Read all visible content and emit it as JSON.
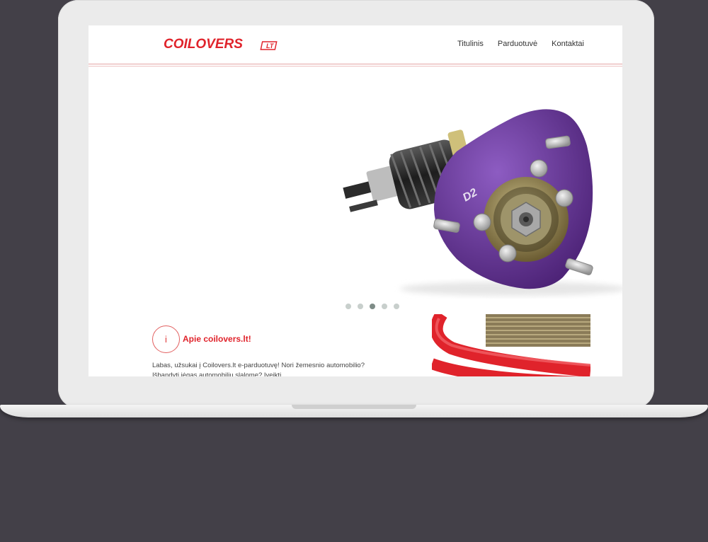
{
  "brand": {
    "logo_text": "COILOVERS",
    "logo_suffix": "LT",
    "accent": "#e0232b"
  },
  "nav": {
    "items": [
      {
        "label": "Titulinis"
      },
      {
        "label": "Parduotuvė"
      },
      {
        "label": "Kontaktai"
      }
    ]
  },
  "hero": {
    "product_mark": "D2",
    "product_colors": {
      "top_mount": "#6a3a9a",
      "spring": "#2a2a2a",
      "bolts": "#c9c9c9"
    }
  },
  "slider": {
    "count": 5,
    "active_index": 2
  },
  "about": {
    "icon": "info-icon",
    "icon_glyph": "i",
    "title": "Apie coilovers.lt!",
    "text": "Labas, užsukai į Coilovers.lt e-parduotuvę! Nori žemesnio automobilio? Išbandyti jėgas automobilių slalome? Įveikti"
  }
}
